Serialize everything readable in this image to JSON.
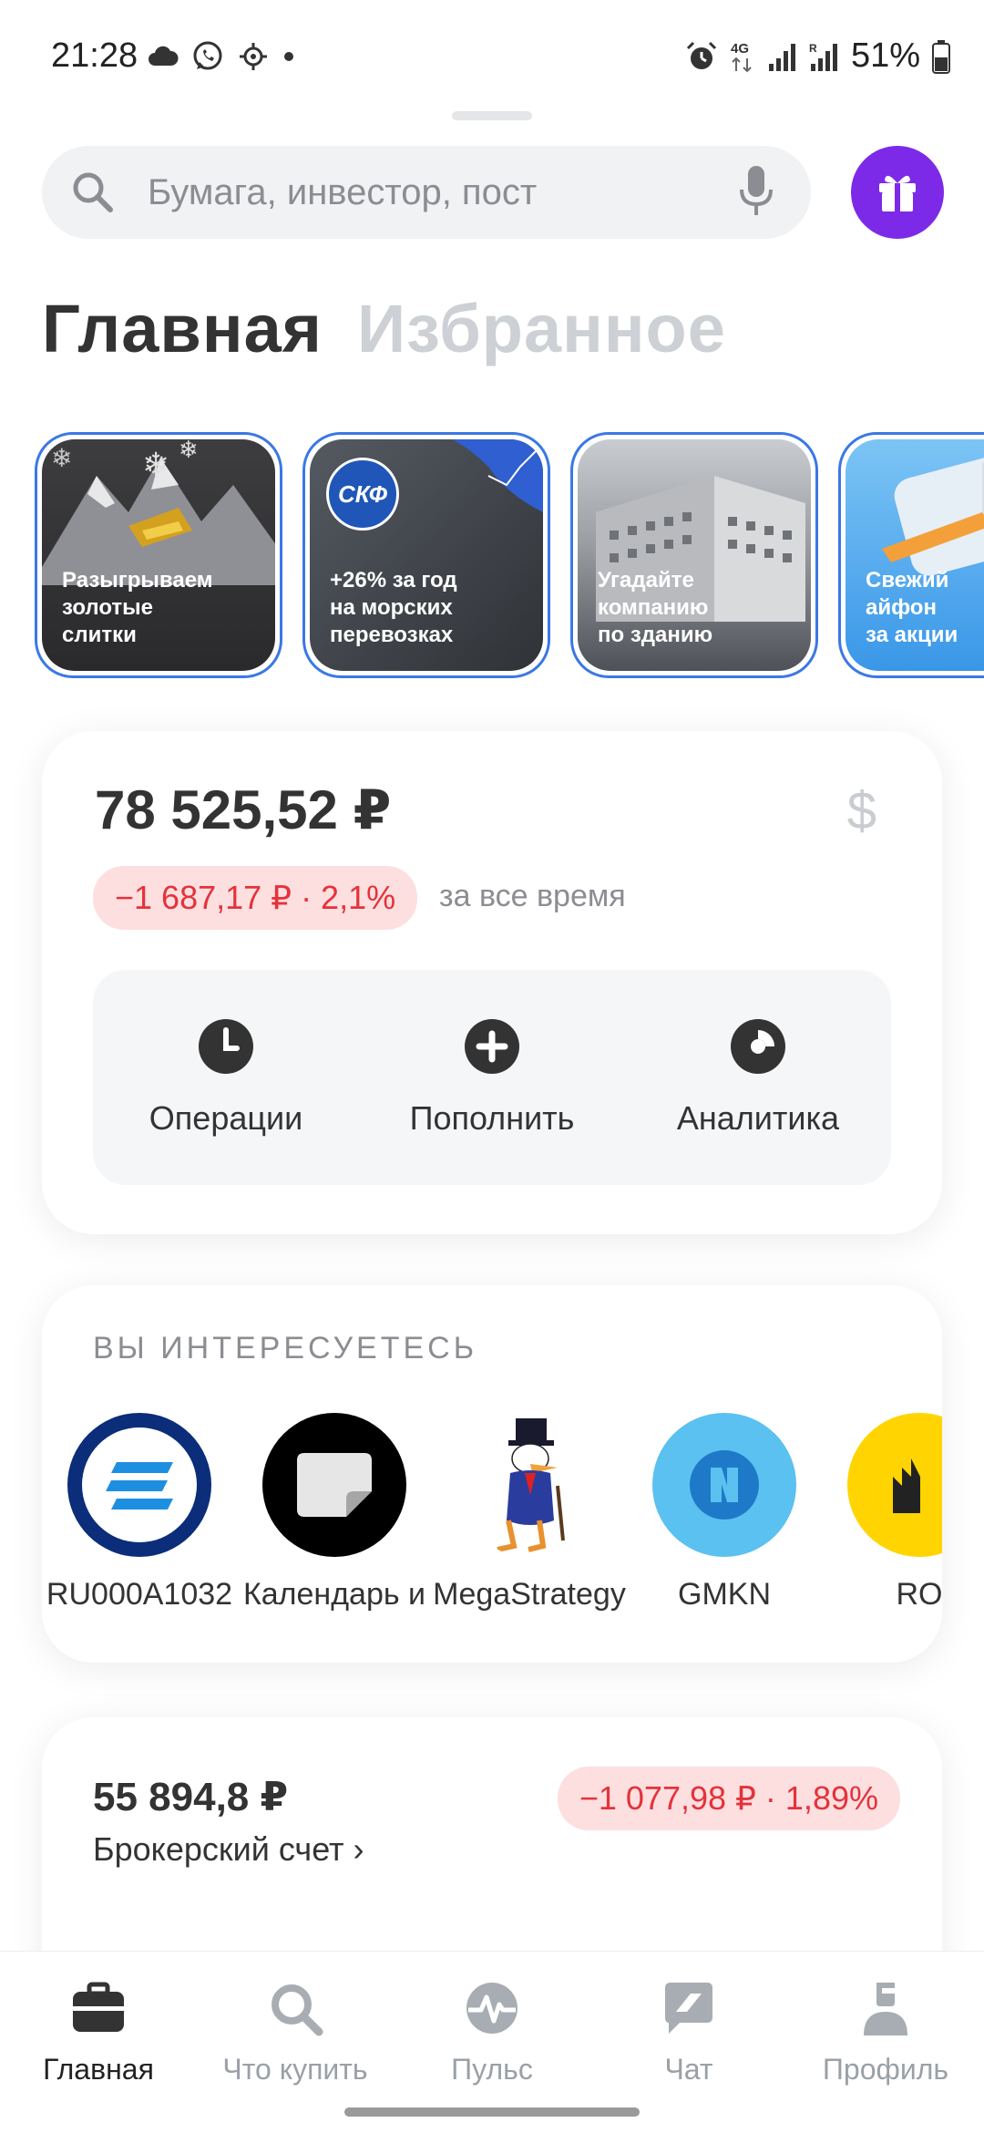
{
  "status_bar": {
    "time": "21:28",
    "battery": "51%",
    "network": "4G",
    "left_icons": [
      "cloud-icon",
      "whatsapp-icon",
      "settings-icon",
      "dot-icon"
    ],
    "right_icons": [
      "alarm-icon",
      "signal-icon",
      "signal-icon",
      "battery-icon"
    ]
  },
  "search": {
    "placeholder": "Бумага, инвестор, пост"
  },
  "tabs": [
    {
      "label": "Главная",
      "active": true
    },
    {
      "label": "Избранное",
      "active": false
    }
  ],
  "stories": [
    {
      "text": "Разыгрываем\nзолотые\nслитки"
    },
    {
      "text": "+26% за год\nна морских\nперевозках",
      "logo": "СКФ"
    },
    {
      "text": "Угадайте\nкомпанию\nпо зданию"
    },
    {
      "text": "Свежий\nайфон\nза акции"
    }
  ],
  "portfolio": {
    "total": "78 525,52 ₽",
    "currency_symbol": "$",
    "change": "−1 687,17 ₽ · 2,1%",
    "period": "за все время",
    "actions": [
      {
        "label": "Операции",
        "icon": "clock-icon"
      },
      {
        "label": "Пополнить",
        "icon": "plus-icon"
      },
      {
        "label": "Аналитика",
        "icon": "donut-chart-icon"
      }
    ]
  },
  "interests": {
    "title": "ВЫ ИНТЕРЕСУЕТЕСЬ",
    "items": [
      {
        "name": "RU000A1032"
      },
      {
        "name": "Календарь и"
      },
      {
        "name": "MegaStrategy"
      },
      {
        "name": "GMKN"
      },
      {
        "name": "RO"
      }
    ]
  },
  "broker": {
    "amount": "55 894,8 ₽",
    "change": "−1 077,98 ₽ · 1,89%",
    "name": "Брокерский счет ›"
  },
  "bottom_nav": [
    {
      "label": "Главная",
      "active": true
    },
    {
      "label": "Что купить",
      "active": false
    },
    {
      "label": "Пульс",
      "active": false
    },
    {
      "label": "Чат",
      "active": false
    },
    {
      "label": "Профиль",
      "active": false
    }
  ],
  "colors": {
    "accent_purple": "#7d2ae8",
    "negative": "#e5323a",
    "negative_bg": "#fddfe0",
    "story_border": "#3a78e6"
  }
}
